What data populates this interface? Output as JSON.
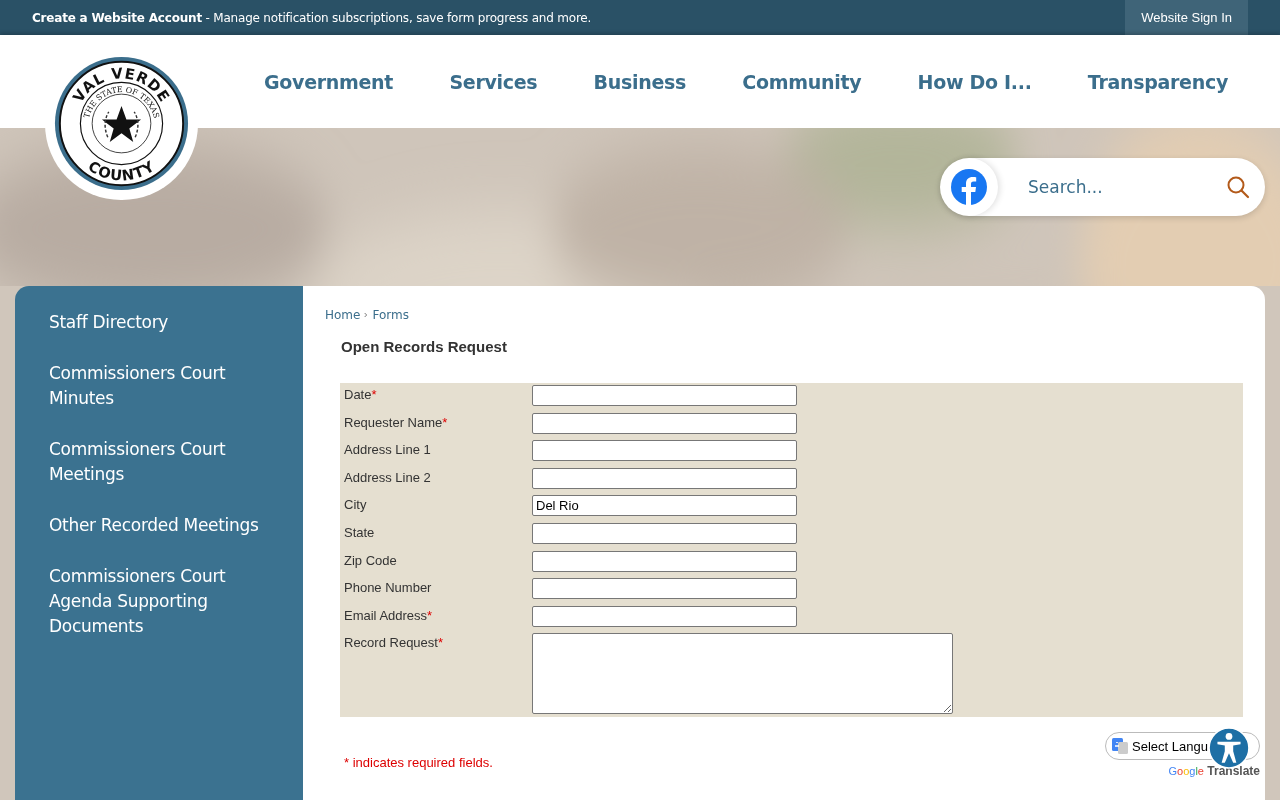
{
  "top_bar": {
    "account_link": "Create a Website Account",
    "account_text": "- Manage notification subscriptions, save form progress and more.",
    "sign_in": "Website Sign In"
  },
  "logo": {
    "top": "VAL VERDE",
    "ring": "THE STATE OF TEXAS",
    "bottom": "COUNTY"
  },
  "nav": [
    "Government",
    "Services",
    "Business",
    "Community",
    "How Do I...",
    "Transparency"
  ],
  "search": {
    "placeholder": "Search..."
  },
  "sidebar": {
    "items": [
      {
        "label": "Staff Directory"
      },
      {
        "label": "Commissioners Court Minutes"
      },
      {
        "label": "Commissioners Court Meetings"
      },
      {
        "label": "Other Recorded Meetings"
      },
      {
        "label": "Commissioners Court Agenda Supporting Documents"
      }
    ]
  },
  "breadcrumb": [
    "Home",
    "Forms"
  ],
  "form": {
    "title": "Open Records Request",
    "fields": [
      {
        "label": "Date",
        "mark": "*",
        "kind": "text"
      },
      {
        "label": "Requester Name",
        "mark": "*",
        "kind": "text"
      },
      {
        "label": "Address Line 1",
        "kind": "text"
      },
      {
        "label": "Address Line 2",
        "kind": "text"
      },
      {
        "label": "City",
        "kind": "text",
        "value": "Del Rio"
      },
      {
        "label": "State",
        "kind": "text"
      },
      {
        "label": "Zip Code",
        "kind": "text"
      },
      {
        "label": "Phone Number",
        "kind": "text"
      },
      {
        "label": "Email Address",
        "mark": "*",
        "kind": "text"
      },
      {
        "label": "Record Request",
        "mark": "*",
        "kind": "textarea"
      }
    ],
    "note": "* indicates required fields."
  },
  "translate": {
    "select": "Select Langu",
    "brand": "Google",
    "label": "Translate"
  }
}
